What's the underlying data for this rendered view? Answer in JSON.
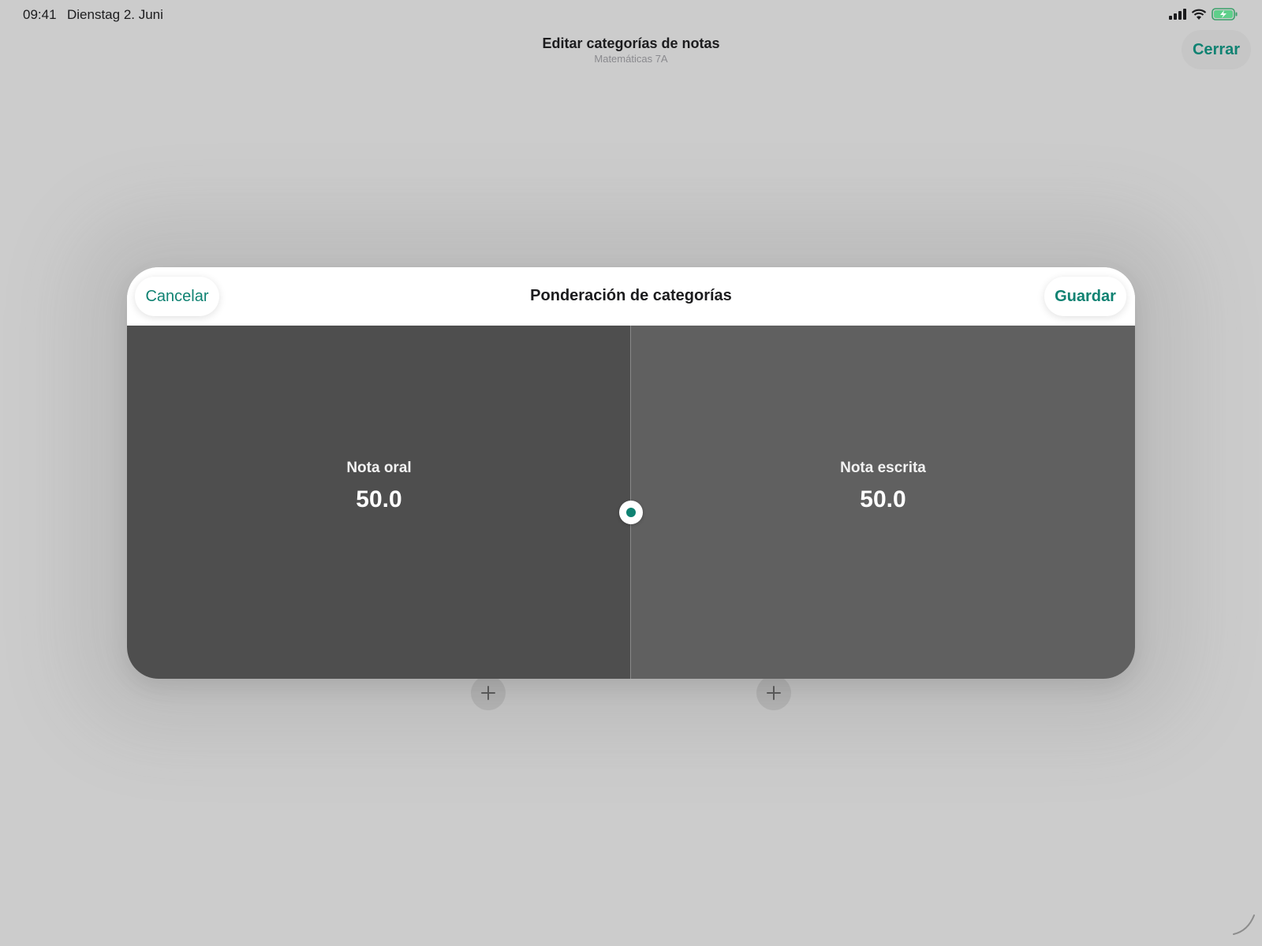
{
  "status_bar": {
    "time": "09:41",
    "date": "Dienstag 2. Juni",
    "icons": [
      "cellular-signal-icon",
      "wifi-icon",
      "battery-charging-icon"
    ]
  },
  "nav": {
    "title": "Editar categorías de notas",
    "subtitle": "Matemáticas 7A",
    "close_label": "Cerrar"
  },
  "modal": {
    "title": "Ponderación de categorías",
    "cancel_label": "Cancelar",
    "save_label": "Guardar",
    "categories": [
      {
        "name": "Nota oral",
        "weight": "50.0"
      },
      {
        "name": "Nota escrita",
        "weight": "50.0"
      }
    ],
    "split_fraction": 0.5
  },
  "background": {
    "add_buttons": [
      "plus-icon",
      "plus-icon"
    ]
  },
  "colors": {
    "accent": "#0f8272",
    "left_pane": "#4e4e4e",
    "right_pane": "#606060",
    "backdrop": "#cccccc"
  }
}
